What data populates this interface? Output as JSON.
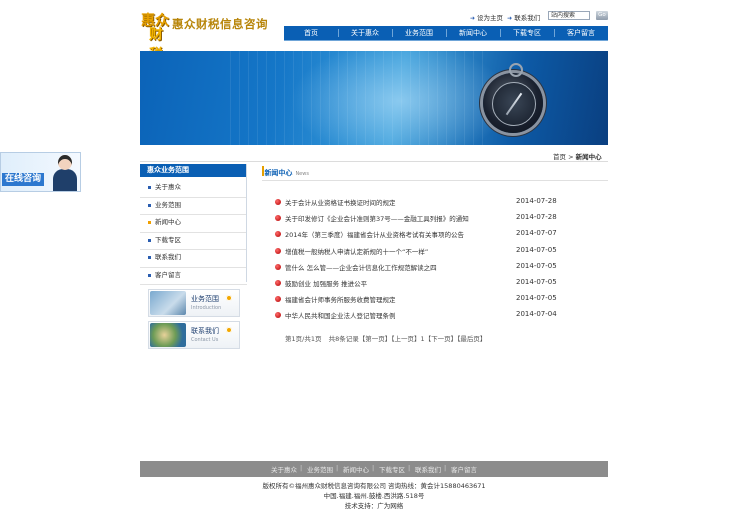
{
  "header": {
    "logo_mark_top": "惠众",
    "logo_mark_bottom": "财税",
    "logo_text": "惠众财税信息咨询",
    "toplinks": [
      "设为主页",
      "联系我们"
    ],
    "search_placeholder": "站内搜索",
    "search_button": "Go"
  },
  "nav": [
    "首页",
    "关于惠众",
    "业务范围",
    "新闻中心",
    "下载专区",
    "客户留言"
  ],
  "float_consult": {
    "label": "在线咨询"
  },
  "breadcrumb": {
    "home": "首页",
    "sep": " > ",
    "current": "新闻中心"
  },
  "sidebar": {
    "title": "惠众业务范围",
    "items": [
      "关于惠众",
      "业务范围",
      "新闻中心",
      "下载专区",
      "联系我们",
      "客户留言"
    ],
    "active_index": 2,
    "promos": [
      {
        "title": "业务范围",
        "subtitle": "Introduction"
      },
      {
        "title": "联系我们",
        "subtitle": "Contact Us"
      }
    ]
  },
  "news": {
    "title": "新闻中心",
    "title_en": "News",
    "items": [
      {
        "title": "关于会计从业资格证书换证时间的规定",
        "date": "2014-07-28"
      },
      {
        "title": "关于印发修订《企业会计准则第37号——金融工具列报》的通知",
        "date": "2014-07-28"
      },
      {
        "title": "2014年（第三季度）福建省会计从业资格考试有关事项的公告",
        "date": "2014-07-07"
      },
      {
        "title": "增值税一般纳税人申请认定新规的十一个“不一样”",
        "date": "2014-07-05"
      },
      {
        "title": "管什么 怎么管——企业会计信息化工作规范解读之四",
        "date": "2014-07-05"
      },
      {
        "title": "鼓励创业 加强服务 推进公平",
        "date": "2014-07-05"
      },
      {
        "title": "福建省会计师事务所服务收费管理规定",
        "date": "2014-07-05"
      },
      {
        "title": "中华人民共和国企业法人登记管理条例",
        "date": "2014-07-04"
      }
    ],
    "pager": [
      "第1页/共1页",
      "共8条记录【第一页】【上一页】1【下一页】【最后页】"
    ]
  },
  "footer": {
    "links": [
      "关于惠众",
      "业务范围",
      "新闻中心",
      "下载专区",
      "联系我们",
      "客户留言"
    ],
    "lines": [
      "版权所有©福州惠众财税信息咨询有限公司 咨询热线：黄会计15880463671",
      "中国.福建.福州.鼓楼.西洪路.518号",
      "技术支持：广为网络"
    ]
  }
}
